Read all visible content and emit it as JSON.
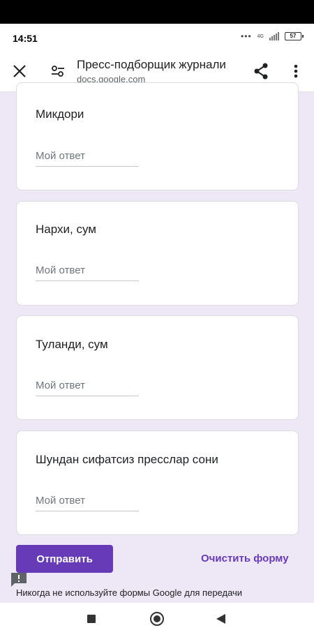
{
  "status": {
    "time": "14:51",
    "network": "4G",
    "battery": "57"
  },
  "app_bar": {
    "title": "Пресс-подборщик журнали",
    "url": "docs.google.com"
  },
  "questions": [
    {
      "label": "Микдори",
      "placeholder": "Мой ответ"
    },
    {
      "label": "Нархи, сум",
      "placeholder": "Мой ответ"
    },
    {
      "label": "Туланди, сум",
      "placeholder": "Мой ответ"
    },
    {
      "label": "Шундан сифатсиз пресслар сони",
      "placeholder": "Мой ответ"
    }
  ],
  "actions": {
    "submit_label": "Отправить",
    "clear_label": "Очистить форму"
  },
  "footer": {
    "note": "Никогда не используйте формы Google для передачи"
  },
  "colors": {
    "accent": "#673ab7",
    "page_background": "#ede7f6"
  },
  "icons": [
    "close-icon",
    "tune-icon",
    "share-icon",
    "more-vert-icon",
    "feedback-icon",
    "recents-icon",
    "home-icon",
    "back-icon"
  ]
}
